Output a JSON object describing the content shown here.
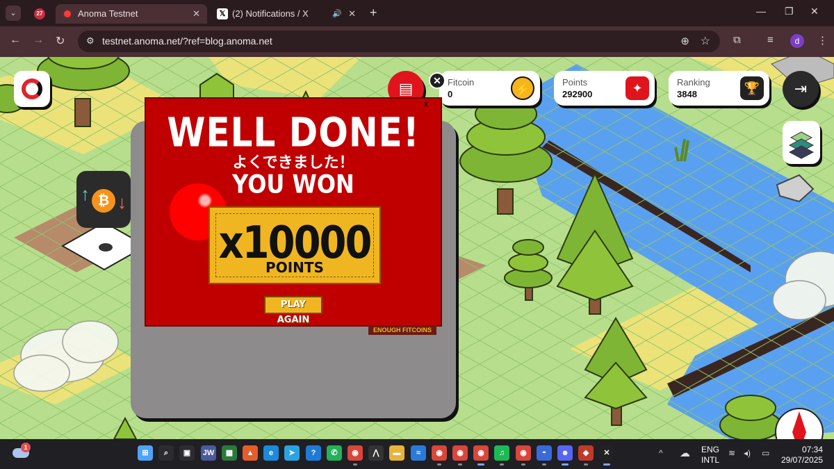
{
  "browser": {
    "tab_menu_label": "⌄",
    "pinned_tab_badge": "27",
    "tabs": [
      {
        "title": "Anoma Testnet"
      },
      {
        "title": "(2) Notifications / X"
      }
    ],
    "new_tab": "+",
    "window_controls": {
      "minimize": "—",
      "maximize": "❐",
      "close": "✕"
    },
    "url": "testnet.anoma.net/?ref=blog.anoma.net",
    "profile_initial": "d"
  },
  "hud": {
    "fitcoin": {
      "label": "Fitcoin",
      "value": "0"
    },
    "points": {
      "label": "Points",
      "value": "292900"
    },
    "ranking": {
      "label": "Ranking",
      "value": "3848"
    },
    "btc_symbol": "₿"
  },
  "modal": {
    "close_glyph": "✕",
    "mini_close": "x",
    "headline": "WELL DONE!",
    "japanese": "よくできました！",
    "subhead": "YOU WON",
    "amount": "x10000",
    "unit": "POINTS",
    "play_again": "PLAY AGAIN",
    "behind_button": "ENOUGH FITCOINS"
  },
  "taskbar": {
    "weather_badge": "1",
    "apps": [
      {
        "name": "start",
        "glyph": "⊞",
        "color": "#4fa3f7"
      },
      {
        "name": "search",
        "glyph": "⌕",
        "color": "#2b2b30"
      },
      {
        "name": "task-view",
        "glyph": "▣",
        "color": "#2b2b30"
      },
      {
        "name": "jw",
        "glyph": "JW",
        "color": "#4a5a9a"
      },
      {
        "name": "store",
        "glyph": "▦",
        "color": "#2b7a3c"
      },
      {
        "name": "brave",
        "glyph": "▲",
        "color": "#e65d2a"
      },
      {
        "name": "edge",
        "glyph": "e",
        "color": "#1c8adb"
      },
      {
        "name": "telegram",
        "glyph": "➤",
        "color": "#2aa3e3"
      },
      {
        "name": "help",
        "glyph": "?",
        "color": "#1f7ad6"
      },
      {
        "name": "whatsapp",
        "glyph": "✆",
        "color": "#25b05a"
      },
      {
        "name": "chrome-1",
        "glyph": "◉",
        "color": "#d9463b"
      },
      {
        "name": "arc",
        "glyph": "⋀",
        "color": "#333"
      },
      {
        "name": "files",
        "glyph": "▬",
        "color": "#e8b33a"
      },
      {
        "name": "jupiter",
        "glyph": "≈",
        "color": "#2b7adb"
      },
      {
        "name": "chrome-2",
        "glyph": "◉",
        "color": "#d9463b"
      },
      {
        "name": "chrome-3",
        "glyph": "◉",
        "color": "#d9463b"
      },
      {
        "name": "chrome-4",
        "glyph": "◉",
        "color": "#d9463b"
      },
      {
        "name": "spotify",
        "glyph": "♫",
        "color": "#1db954"
      },
      {
        "name": "chrome-5",
        "glyph": "◉",
        "color": "#d9463b"
      },
      {
        "name": "notchrome",
        "glyph": "◓",
        "color": "#3a6ad6"
      },
      {
        "name": "discord",
        "glyph": "☻",
        "color": "#5865f2"
      },
      {
        "name": "game",
        "glyph": "◆",
        "color": "#c03a2b"
      },
      {
        "name": "capcut",
        "glyph": "✕",
        "color": "#222"
      }
    ],
    "tray": {
      "chevron": "^",
      "cloud": "☁",
      "lang_line1": "ENG",
      "lang_line2": "INTL",
      "wifi": "≋",
      "volume": "◂)",
      "battery": "▭"
    },
    "time": "07:34",
    "date": "29/07/2025"
  }
}
